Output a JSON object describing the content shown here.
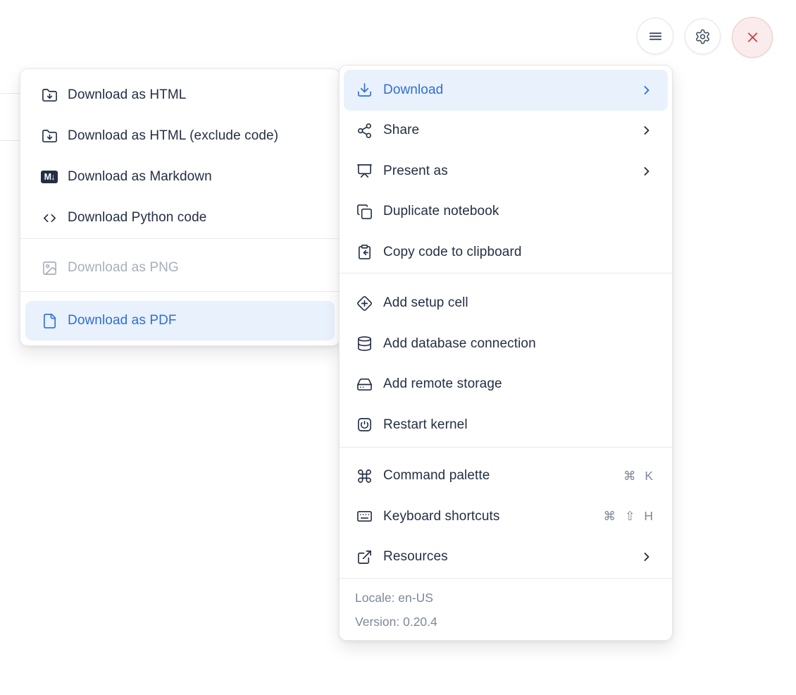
{
  "topbar": {
    "buttons": [
      {
        "name": "notebook-menu",
        "icon": "hamburger-icon"
      },
      {
        "name": "settings",
        "icon": "gear-icon"
      },
      {
        "name": "shutdown",
        "icon": "close-icon"
      }
    ]
  },
  "download_submenu": {
    "markdown_badge": "M↓",
    "groups": [
      {
        "items": [
          {
            "label": "Download as HTML",
            "icon": "folder-download-icon"
          },
          {
            "label": "Download as HTML (exclude code)",
            "icon": "folder-download-icon"
          },
          {
            "label": "Download as Markdown",
            "icon": "markdown-icon"
          },
          {
            "label": "Download Python code",
            "icon": "code-icon"
          }
        ]
      },
      {
        "items": [
          {
            "label": "Download as PNG",
            "icon": "image-icon",
            "disabled": true
          }
        ]
      },
      {
        "items": [
          {
            "label": "Download as PDF",
            "icon": "file-icon",
            "highlighted": true
          }
        ]
      }
    ]
  },
  "main_menu": {
    "groups": [
      {
        "items": [
          {
            "label": "Download",
            "icon": "download-icon",
            "submenu": true,
            "highlighted": true
          },
          {
            "label": "Share",
            "icon": "share-icon",
            "submenu": true
          },
          {
            "label": "Present as",
            "icon": "presentation-icon",
            "submenu": true
          },
          {
            "label": "Duplicate notebook",
            "icon": "duplicate-icon"
          },
          {
            "label": "Copy code to clipboard",
            "icon": "clipboard-copy-icon"
          }
        ]
      },
      {
        "items": [
          {
            "label": "Add setup cell",
            "icon": "diamond-plus-icon"
          },
          {
            "label": "Add database connection",
            "icon": "database-icon"
          },
          {
            "label": "Add remote storage",
            "icon": "hard-drive-icon"
          },
          {
            "label": "Restart kernel",
            "icon": "power-square-icon"
          }
        ]
      },
      {
        "items": [
          {
            "label": "Command palette",
            "icon": "command-icon",
            "shortcut": "⌘ K"
          },
          {
            "label": "Keyboard shortcuts",
            "icon": "keyboard-icon",
            "shortcut": "⌘ ⇧ H"
          },
          {
            "label": "Resources",
            "icon": "external-link-icon",
            "submenu": true
          }
        ]
      }
    ],
    "footer": {
      "locale": "Locale: en-US",
      "version": "Version: 0.20.4"
    }
  },
  "colors": {
    "accent_blue": "#2e6fd3",
    "highlight_bg": "#e9f1fc",
    "text": "#242f44",
    "muted_gray": "#7d8799",
    "disabled_gray": "#a8afbb",
    "separator": "#e7eaee",
    "danger_red": "#ce3c3c",
    "danger_bg": "#faecec"
  }
}
